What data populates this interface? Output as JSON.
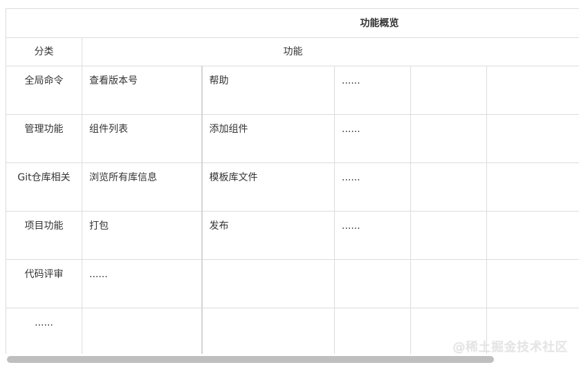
{
  "table": {
    "title": "功能概览",
    "header": {
      "category": "分类",
      "features": "功能"
    },
    "rows": [
      {
        "category": "全局命令",
        "f1": "查看版本号",
        "f2": "帮助",
        "f3": "......"
      },
      {
        "category": "管理功能",
        "f1": "组件列表",
        "f2": "添加组件",
        "f3": "......"
      },
      {
        "category": "Git仓库相关",
        "f1": "浏览所有库信息",
        "f2": "模板库文件",
        "f3": "......"
      },
      {
        "category": "项目功能",
        "f1": "打包",
        "f2": "发布",
        "f3": "......"
      },
      {
        "category": "代码评审",
        "f1": "......",
        "f2": "",
        "f3": ""
      },
      {
        "category": "......",
        "f1": "",
        "f2": "",
        "f3": ""
      }
    ]
  },
  "watermark_text": "@稀土掘金技术社区"
}
